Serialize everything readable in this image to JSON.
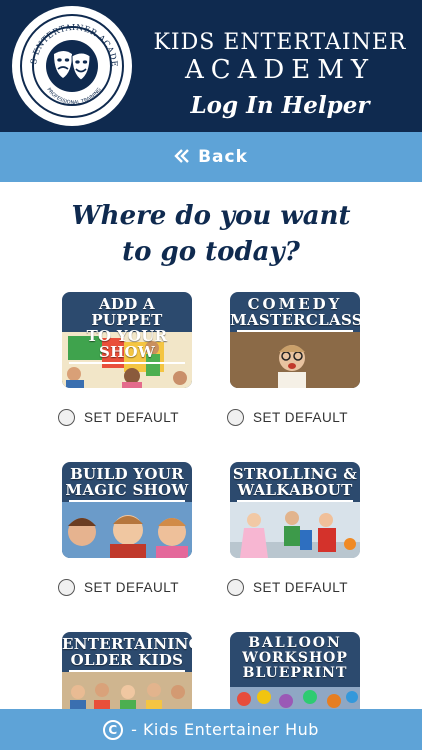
{
  "header": {
    "logo_arc_text": "KIDS ENTERTAINER ACADEMY",
    "logo_bottom_text": "PROFESSIONAL TRAINING",
    "title_line1": "KIDS ENTERTAINER",
    "title_line2": "ACADEMY",
    "subtitle": "Log In Helper"
  },
  "back": {
    "label": "Back",
    "icon": "double-chevron-left-icon"
  },
  "question": {
    "line1": "Where do you want",
    "line2": "to go today?"
  },
  "courses": [
    {
      "title_line1": "ADD A PUPPET",
      "title_line2": "TO YOUR SHOW",
      "radio_label": "SET DEFAULT"
    },
    {
      "title_line1": "COMEDY",
      "title_line2": "MASTERCLASS",
      "radio_label": "SET DEFAULT"
    },
    {
      "title_line1": "BUILD YOUR",
      "title_line2": "MAGIC SHOW",
      "radio_label": "SET DEFAULT"
    },
    {
      "title_line1": "STROLLING &",
      "title_line2": "WALKABOUT",
      "radio_label": "SET DEFAULT"
    },
    {
      "title_line1": "ENTERTAINING",
      "title_line2": "OLDER KIDS"
    },
    {
      "title_line1": "BALLOON",
      "title_line2": "WORKSHOP",
      "title_line3": "BLUEPRINT"
    }
  ],
  "footer": {
    "copyright_symbol": "C",
    "text": "- Kids Entertainer Hub"
  },
  "colors": {
    "navy": "#0f2a4f",
    "sky_blue": "#5ea3d7",
    "card_bg": "#2c4a6e"
  }
}
